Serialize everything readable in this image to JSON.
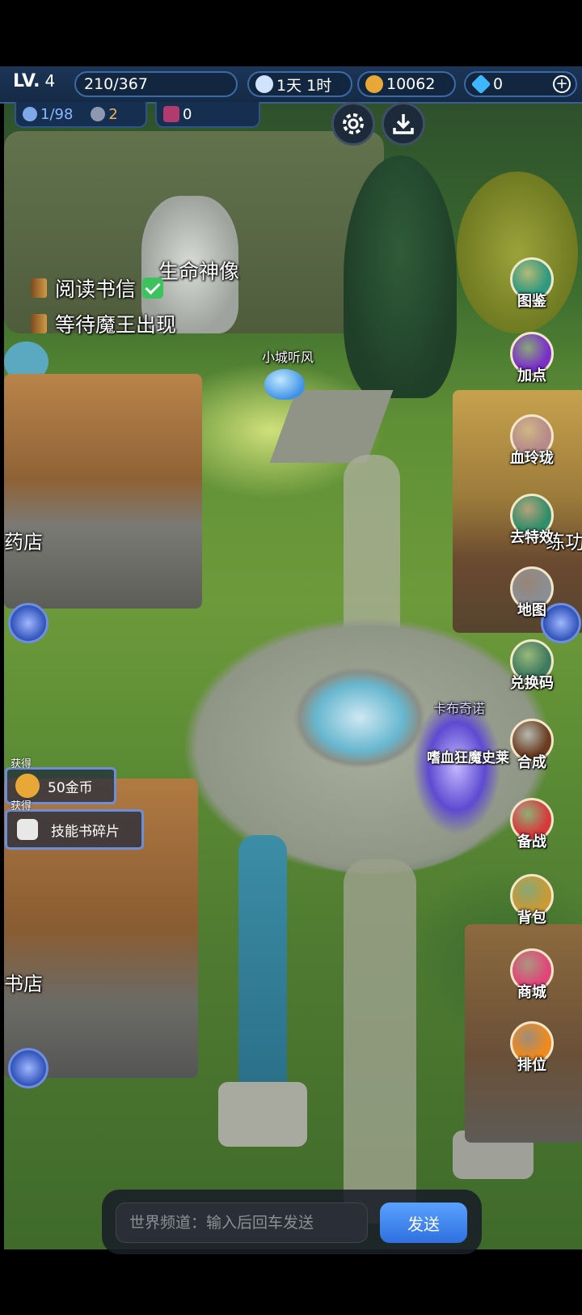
{
  "hud": {
    "level_label": "LV.",
    "level_value": "4",
    "exp": "210/367",
    "time": "1天 1时",
    "gold": "10062",
    "diamonds": "0",
    "stat_a": "1/98",
    "stat_b": "2",
    "stat_c": "0"
  },
  "quests": [
    {
      "label": "阅读书信",
      "done": true
    },
    {
      "label": "等待魔王出现",
      "done": false
    }
  ],
  "map_labels": {
    "statue": "生命神像",
    "player": "小城听风",
    "pharmacy": "药店",
    "bookstore": "书店",
    "right_building": "练功房",
    "hero_name_1": "卡布奇诺",
    "hero_name_2": "嗜血狂魔史莱"
  },
  "side_menu": [
    {
      "label": "图鉴",
      "icon": "paw-icon",
      "color": "#2f9a7f"
    },
    {
      "label": "加点",
      "icon": "flame-icon",
      "color": "#7a2fc9"
    },
    {
      "label": "血玲珑",
      "icon": "heart-icon",
      "color": "#b78a8a"
    },
    {
      "label": "去特效",
      "icon": "sparkle-icon",
      "color": "#2f8f6a"
    },
    {
      "label": "地图",
      "icon": "map-icon",
      "color": "#8b8e95"
    },
    {
      "label": "兑换码",
      "icon": "code-icon",
      "color": "#3e7a5f"
    },
    {
      "label": "合成",
      "icon": "yin-yang-icon",
      "color": "#6b3c22"
    },
    {
      "label": "备战",
      "icon": "swords-icon",
      "color": "#d63a3a"
    },
    {
      "label": "背包",
      "icon": "bag-icon",
      "color": "#c99a35"
    },
    {
      "label": "商城",
      "icon": "shop-icon",
      "color": "#e1457a"
    },
    {
      "label": "排位",
      "icon": "crown-icon",
      "color": "#f08a1e"
    }
  ],
  "rewards": [
    {
      "tag": "获得",
      "text": "50金币"
    },
    {
      "tag": "获得",
      "text": "技能书碎片"
    }
  ],
  "chat": {
    "placeholder": "世界频道：输入后回车发送",
    "send_label": "发送"
  },
  "colors": {
    "hud_bg": "#152a46",
    "hud_border": "#3b6aa5",
    "send_button": "#2f6fe0",
    "toast_border": "#6e8fd8"
  }
}
